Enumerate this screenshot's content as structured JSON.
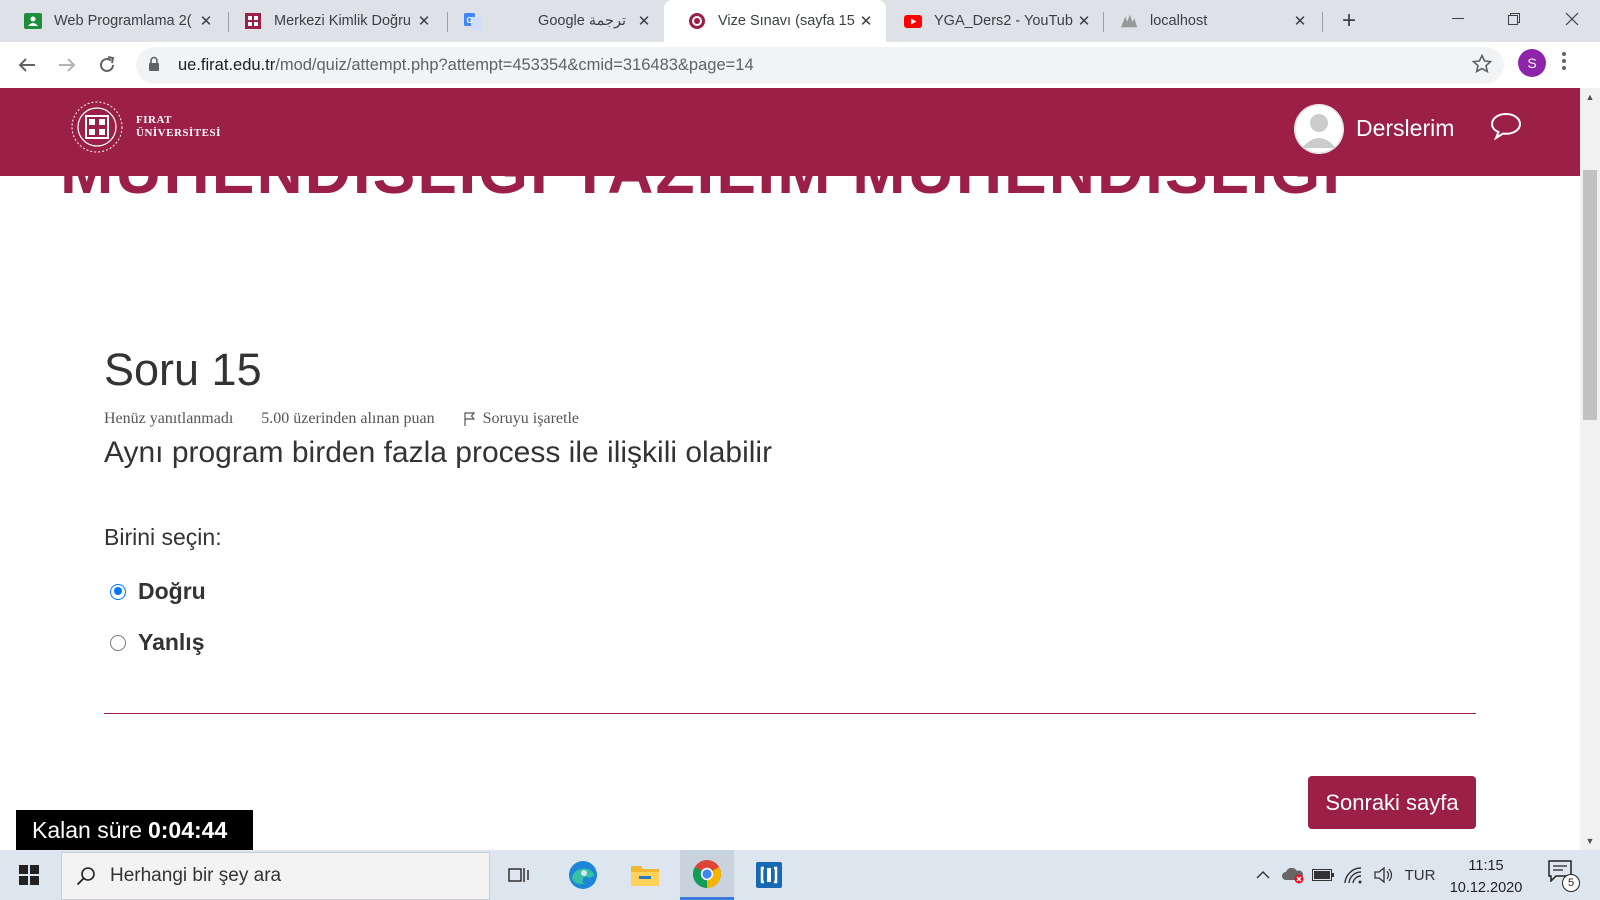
{
  "browser": {
    "tabs": [
      {
        "title": "Web Programlama 2(",
        "icon": "classroom-icon"
      },
      {
        "title": "Merkezi Kimlik Doğru",
        "icon": "firat-icon"
      },
      {
        "title": "Google ترجمة",
        "icon": "translate-icon"
      },
      {
        "title": "Vize Sınavı (sayfa 15 )",
        "icon": "moodle-icon",
        "active": true
      },
      {
        "title": "YGA_Ders2 - YouTub",
        "icon": "youtube-icon"
      },
      {
        "title": "localhost",
        "icon": "phpmyadmin-icon"
      }
    ],
    "url_host": "ue.firat.edu.tr",
    "url_path": "/mod/quiz/attempt.php?attempt=453354&cmid=316483&page=14",
    "profile_initial": "S",
    "profile_color": "#8e24aa"
  },
  "header": {
    "logo_line1": "FIRAT",
    "logo_line2": "ÜNİVERSİTESİ",
    "menu_label": "Derslerim",
    "brand_color": "#9c1f48"
  },
  "question": {
    "number": "Soru 15",
    "status": "Henüz yanıtlanmadı",
    "points": "5.00 üzerinden alınan puan",
    "flag_label": "Soruyu işaretle",
    "text": "Aynı program birden fazla process ile ilişkili olabilir",
    "prompt": "Birini seçin:",
    "options": [
      {
        "label": "Doğru",
        "checked": true
      },
      {
        "label": "Yanlış",
        "checked": false
      }
    ]
  },
  "navigation": {
    "next_label": "Sonraki sayfa"
  },
  "timer": {
    "label": "Kalan süre",
    "value": "0:04:44"
  },
  "taskbar": {
    "search_placeholder": "Herhangi bir şey ara",
    "language": "TUR",
    "time": "11:15",
    "date": "10.12.2020",
    "notification_count": "5"
  }
}
